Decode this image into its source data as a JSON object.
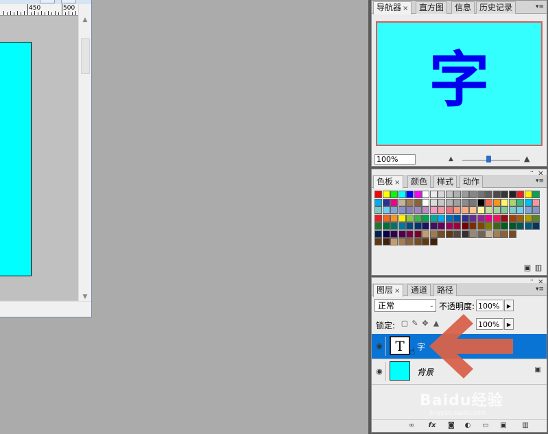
{
  "document": {
    "ruler_numbers": [
      "450",
      "500"
    ]
  },
  "navigator": {
    "tabs": [
      {
        "label": "导航器",
        "close": "×"
      },
      {
        "label": "直方图"
      },
      {
        "label": "信息"
      },
      {
        "label": "历史记录"
      }
    ],
    "preview_char": "字",
    "zoom": "100%",
    "colors": {
      "preview_bg": "#33ffff",
      "preview_char": "#0000ee",
      "view_box": "#e05a5a"
    }
  },
  "swatches": {
    "tabs": [
      {
        "label": "色板",
        "close": "×"
      },
      {
        "label": "颜色"
      },
      {
        "label": "样式"
      },
      {
        "label": "动作"
      }
    ],
    "rows": [
      [
        "#ff0000",
        "#ffff00",
        "#00ff00",
        "#00ffff",
        "#0000ff",
        "#ff00ff",
        "#ffffff",
        "#ebebeb",
        "#d7d7d7",
        "#c3c3c3",
        "#afafaf",
        "#9b9b9b",
        "#878787",
        "#737373",
        "#5f5f5f",
        "#4b4b4b",
        "#373737",
        "#232323",
        "#ee1d24",
        "#fff200",
        "#00a651"
      ],
      [
        "#00aeef",
        "#2e3192",
        "#ec008c",
        "#c7b299",
        "#a87c4f",
        "#8c6239",
        "#ffffff",
        "#dcdcdc",
        "#c8c8c8",
        "#b4b4b4",
        "#a0a0a0",
        "#8c8c8c",
        "#787878",
        "#000000",
        "#f26c4f",
        "#f7941d",
        "#fff568",
        "#acd373",
        "#3cb878",
        "#00bff3",
        "#f5989d"
      ],
      [
        "#7accc8",
        "#6dcff6",
        "#7da7d9",
        "#8393ca",
        "#8781bd",
        "#a187be",
        "#bd8cbf",
        "#f49ac2",
        "#f5989d",
        "#f26d7d",
        "#f7977a",
        "#fbad82",
        "#fdc68a",
        "#fff79a",
        "#c4df9b",
        "#a3d39c",
        "#82ca9d",
        "#7bcdc8",
        "#6ecff6",
        "#7ea7d8",
        "#8493ca"
      ],
      [
        "#ed1c24",
        "#f26522",
        "#f7941d",
        "#fff200",
        "#8dc63f",
        "#39b54a",
        "#00a651",
        "#00a99d",
        "#00aeef",
        "#0072bc",
        "#0054a6",
        "#2e3192",
        "#662d91",
        "#92278f",
        "#ec008c",
        "#ed145b",
        "#9e0b0f",
        "#a0410d",
        "#a3620a",
        "#aba000",
        "#598527"
      ],
      [
        "#1a7b30",
        "#007236",
        "#00746b",
        "#0076a3",
        "#004a80",
        "#003471",
        "#1b1464",
        "#440e62",
        "#630460",
        "#9e005d",
        "#9e0039",
        "#790000",
        "#7b2e00",
        "#7d4900",
        "#827b00",
        "#406618",
        "#005e20",
        "#005826",
        "#005952",
        "#005b7f",
        "#003663"
      ],
      [
        "#002157",
        "#0d004c",
        "#32004b",
        "#4b0049",
        "#7b0046",
        "#7a0026",
        "#c69c6d",
        "#9e7a4f",
        "#754c24",
        "#603913",
        "#534741",
        "#362f2d",
        "#998675",
        "#736357",
        "#c7b299",
        "#a67c52",
        "#8c6239",
        "#754c24"
      ],
      [
        "#603913",
        "#42210b",
        "#c69c6d",
        "#a67c52",
        "#8c6239",
        "#754c24",
        "#603913",
        "#42210b"
      ]
    ]
  },
  "layers": {
    "tabs": [
      {
        "label": "图层",
        "close": "×"
      },
      {
        "label": "通道"
      },
      {
        "label": "路径"
      }
    ],
    "blend_mode": "正常",
    "opacity_label": "不透明度:",
    "opacity": "100%",
    "lock_label": "锁定:",
    "fill": "100%",
    "items": [
      {
        "name": "字",
        "thumb": "T",
        "selected": true
      },
      {
        "name": "背景",
        "locked": true
      }
    ],
    "colors": {
      "selected_row": "#0a74d4",
      "background_thumb": "#00ffff"
    }
  },
  "overlay": {
    "arrow_color": "#d8624a",
    "watermark": "Baidu经验",
    "watermark_sub": "jingyan.baidu.com"
  },
  "icons": {
    "close": "×",
    "panel_menu": "▾≡",
    "eye": "👁",
    "lock": "🔒",
    "link": "∞",
    "fx": "fx",
    "trash": "🗑"
  }
}
